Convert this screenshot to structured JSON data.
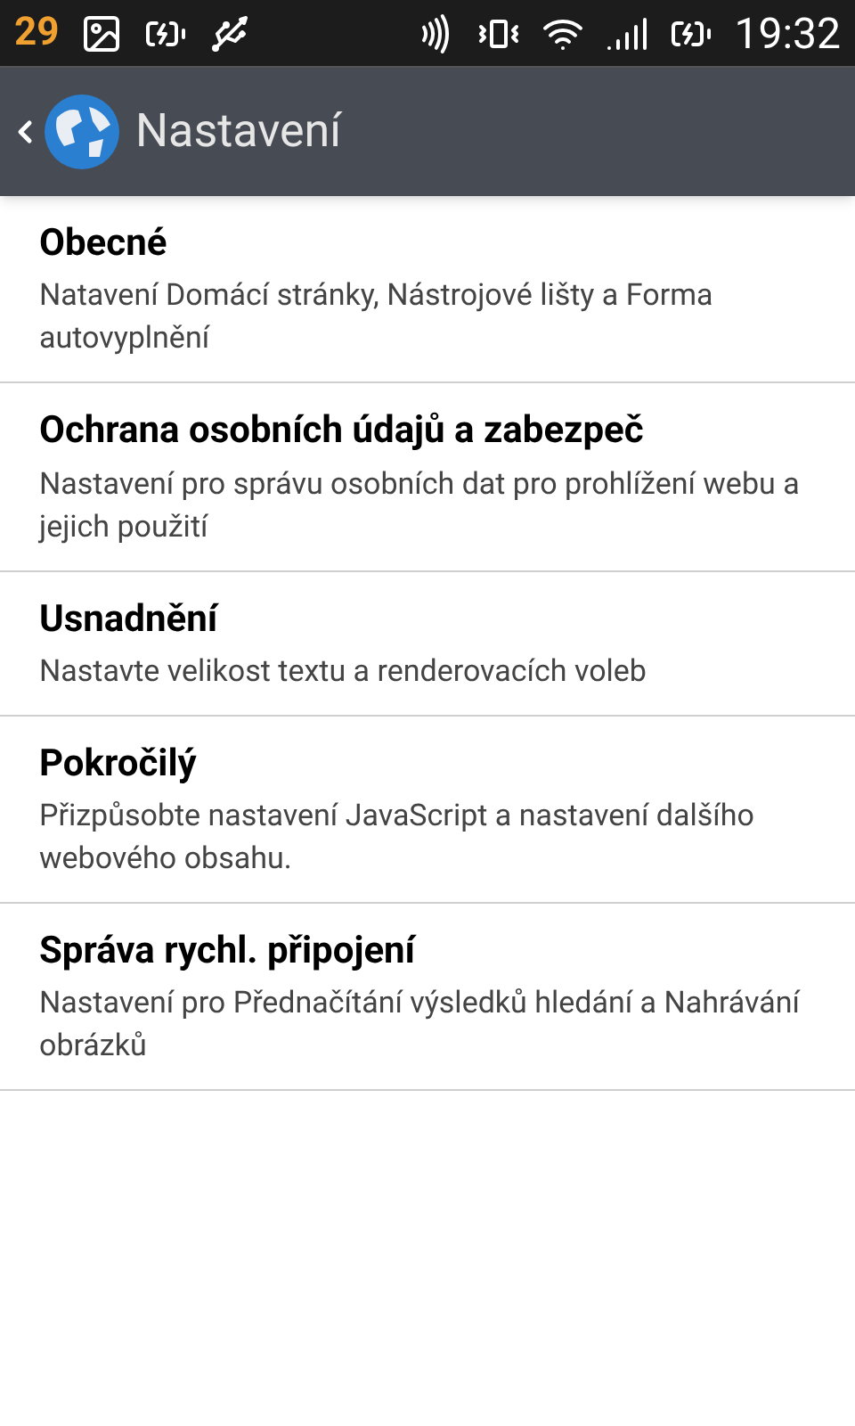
{
  "status_bar": {
    "notification_count": "29",
    "time": "19:32"
  },
  "header": {
    "title": "Nastavení"
  },
  "settings": [
    {
      "title": "Obecné",
      "summary": "Natavení Domácí stránky, Nástrojové lišty a Forma autovyplnění"
    },
    {
      "title": "Ochrana osobních údajů a zabezpeč",
      "summary": "Nastavení pro správu osobních dat pro prohlížení webu a jejich použití"
    },
    {
      "title": "Usnadnění",
      "summary": "Nastavte velikost textu a renderovacích voleb"
    },
    {
      "title": "Pokročilý",
      "summary": "Přizpůsobte nastavení JavaScript a nastavení dalšího webového obsahu."
    },
    {
      "title": "Správa rychl. připojení",
      "summary": "Nastavení pro Přednačítání výsledků hledání a Nahrávání  obrázků"
    }
  ]
}
